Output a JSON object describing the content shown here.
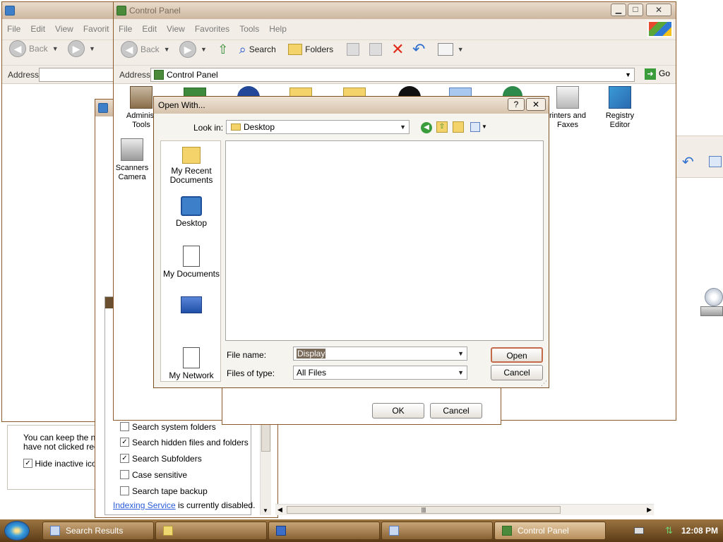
{
  "colors": {
    "accent": "#3d7fc9",
    "taskbar": "#7a5428",
    "titlebar": "#d7c3ad"
  },
  "control_panel": {
    "title": "Control Panel",
    "menu": [
      "File",
      "Edit",
      "View",
      "Favorites",
      "Tools",
      "Help"
    ],
    "toolbar": {
      "back": "Back",
      "search": "Search",
      "folders": "Folders"
    },
    "address_label": "Address",
    "address_value": "Control Panel",
    "go": "Go",
    "icons": [
      {
        "label": "Administrative Tools",
        "display": "Administ\nTools"
      },
      {
        "label": "Printers and Faxes",
        "display": "rinters and\nFaxes"
      },
      {
        "label": "Registry Editor",
        "display": "Registry\nEditor"
      },
      {
        "label": "Scanners and Cameras",
        "display": "Scanners\nCamera"
      }
    ]
  },
  "back_window": {
    "menu": [
      "File",
      "Edit",
      "View",
      "Favorit"
    ],
    "back": "Back",
    "address_label": "Address",
    "notice_line1": "You can keep the no",
    "notice_line2": "have not clicked rece",
    "hide_label": "Hide inactive icon"
  },
  "search_panel": {
    "items": [
      {
        "label": "Search system folders",
        "checked": false
      },
      {
        "label": "Search hidden files and folders",
        "checked": true
      },
      {
        "label": "Search Subfolders",
        "checked": true
      },
      {
        "label": "Case sensitive",
        "checked": false
      },
      {
        "label": "Search tape backup",
        "checked": false
      }
    ],
    "indexing_link": "Indexing Service",
    "indexing_rest": " is currently disabled."
  },
  "behind_dialog": {
    "ok": "OK",
    "cancel": "Cancel"
  },
  "open_with": {
    "title": "Open With...",
    "look_in_label": "Look in:",
    "look_in_value": "Desktop",
    "places": [
      "My Recent\nDocuments",
      "Desktop",
      "My Documents",
      "My Network"
    ],
    "file_name_label": "File name:",
    "file_name_value": "Display",
    "files_of_type_label": "Files of type:",
    "files_of_type_value": "All Files",
    "open": "Open",
    "cancel": "Cancel",
    "help": "?",
    "close": "✕"
  },
  "taskbar": {
    "items": [
      "Search Results",
      "",
      "",
      "",
      "Control Panel"
    ],
    "clock": "12:08 PM"
  }
}
